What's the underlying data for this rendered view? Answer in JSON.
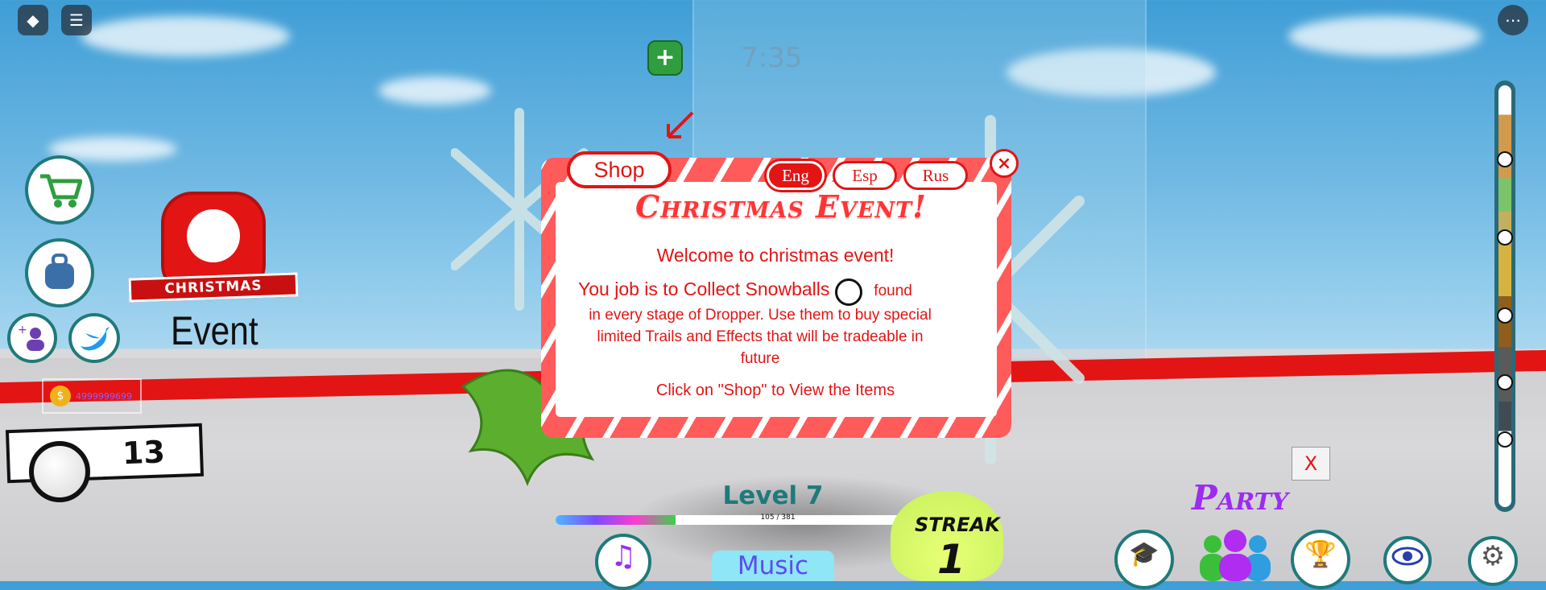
{
  "timer": "7:35",
  "event": {
    "badge_text": "CHRISTMAS",
    "label": "Event"
  },
  "currency": {
    "amount": "4999999699"
  },
  "snowballs": {
    "count": "13"
  },
  "dialog": {
    "shop_label": "Shop",
    "languages": [
      {
        "label": "Eng",
        "active": true
      },
      {
        "label": "Esp",
        "active": false
      },
      {
        "label": "Rus",
        "active": false
      }
    ],
    "close_label": "×",
    "title": "Christmas Event!",
    "welcome": "Welcome to christmas event!",
    "line1": "You job is to Collect Snowballs",
    "line1_suffix": "found",
    "body": "in every stage of Dropper. Use them to buy special limited Trails and Effects that will be tradeable in future",
    "cta": "Click on \"Shop\" to View the Items"
  },
  "level": {
    "label": "Level 7",
    "progress_text": "105 / 381",
    "progress_fraction": 0.276
  },
  "music_label": "Music",
  "streak": {
    "label": "STREAK",
    "value": "1"
  },
  "party_label": "Party",
  "small_close_label": "X",
  "icons": [
    "roblox-icon",
    "chat-icon",
    "menu-icon",
    "add-icon",
    "cart-icon",
    "backpack-icon",
    "add-friends-icon",
    "twitter-icon",
    "coin-icon",
    "snowball-icon",
    "music-icon",
    "graduation-icon",
    "party-icon",
    "trophy-icon",
    "eye-icon",
    "settings-icon"
  ],
  "colors": {
    "accent_red": "#e31414",
    "teal": "#1f7a7a",
    "party_purple": "#9b2cf0"
  }
}
